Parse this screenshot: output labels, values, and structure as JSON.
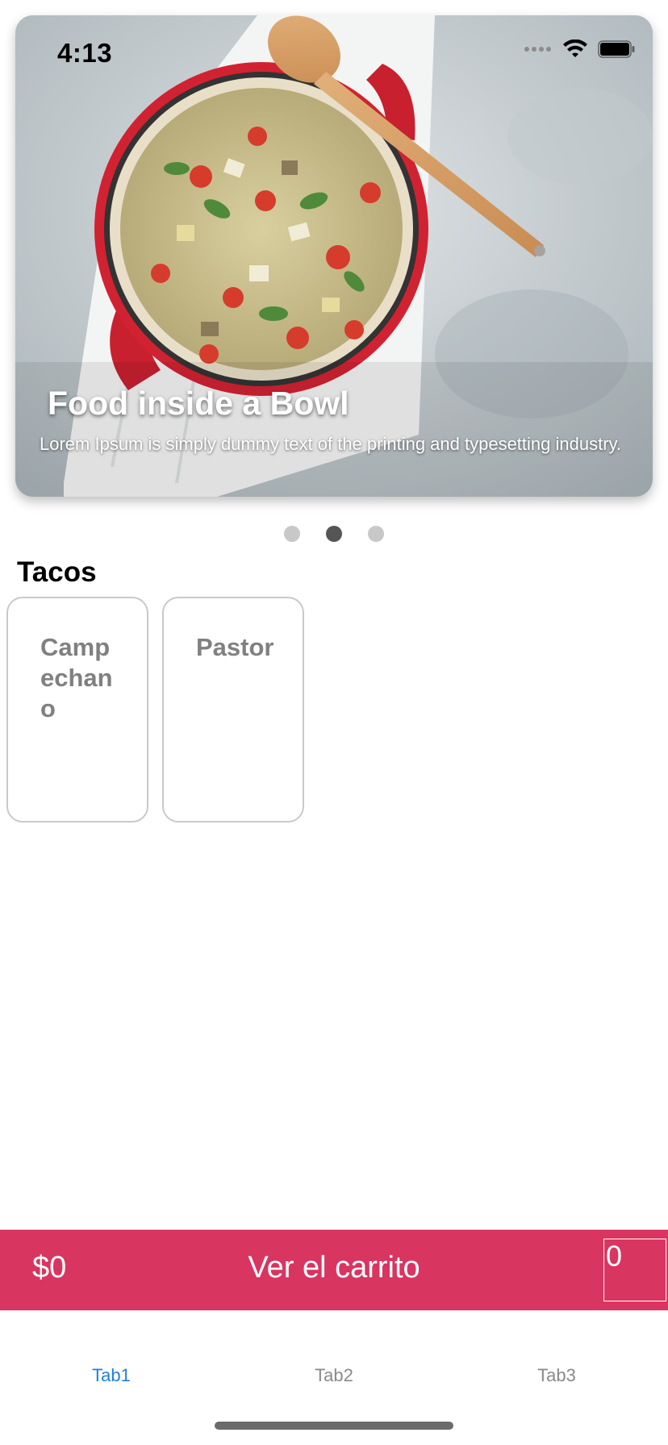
{
  "status_bar": {
    "time": "4:13"
  },
  "carousel": {
    "slides": [
      {
        "title": "Food inside a Bowl",
        "subtitle": "Lorem Ipsum is simply dummy text of the printing and typesetting industry."
      }
    ],
    "page_count": 3,
    "active_page": 2
  },
  "section": {
    "title": "Tacos",
    "items": [
      {
        "label": "Campechano"
      },
      {
        "label": "Pastor"
      }
    ]
  },
  "cart": {
    "total": "$0",
    "label": "Ver el carrito",
    "count": "0"
  },
  "tabs": [
    {
      "label": "Tab1",
      "active": true
    },
    {
      "label": "Tab2",
      "active": false
    },
    {
      "label": "Tab3",
      "active": false
    }
  ],
  "colors": {
    "accent": "#d93561",
    "active_tab": "#1f7fe0",
    "inactive_tab": "#8a8a8a"
  }
}
